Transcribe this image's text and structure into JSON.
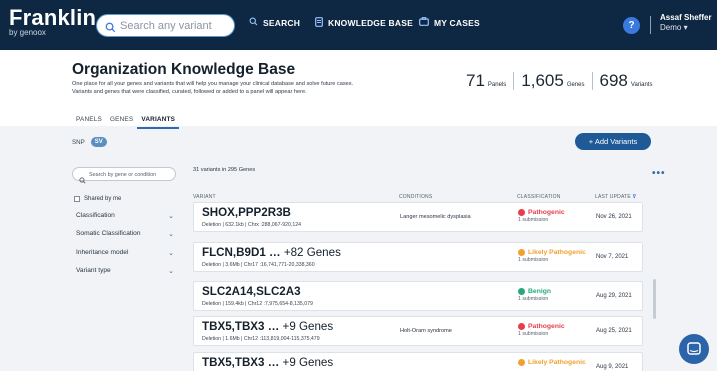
{
  "app": {
    "logo": "Franklin",
    "logo_sub": "by genoox"
  },
  "search": {
    "placeholder": "Search any variant"
  },
  "nav": {
    "search": "SEARCH",
    "knowledge_base": "KNOWLEDGE BASE",
    "my_cases": "MY CASES"
  },
  "user": {
    "name": "Assaf Sheffer",
    "org": "Demo ▾",
    "help": "?"
  },
  "page": {
    "title": "Organization Knowledge Base",
    "desc_line1": "One place for all your genes and variants that will help you manage your clinical database and solve future cases.",
    "desc_line2": "Variants and genes that were classified, curated, followed or added to a panel will appear here."
  },
  "stats": [
    {
      "value": "71",
      "label": "Panels"
    },
    {
      "value": "1,605",
      "label": "Genes"
    },
    {
      "value": "698",
      "label": "Variants"
    }
  ],
  "tabs": [
    "PANELS",
    "GENES",
    "VARIANTS"
  ],
  "chips": {
    "snp": "SNP",
    "sv": "SV"
  },
  "add_button": "+ Add Variants",
  "more": "•••",
  "filters": {
    "search_placeholder": "Search by gene or condition",
    "shared": "Shared by me",
    "items": [
      "Classification",
      "Somatic Classification",
      "Inheritance model",
      "Variant type"
    ]
  },
  "table": {
    "count": "31 variants in 295 Genes",
    "headers": {
      "variant": "VARIANT",
      "conditions": "CONDITIONS",
      "classification": "CLASSIFICATION",
      "last_update": "LAST UPDATE"
    },
    "rows": [
      {
        "name": "SHOX,PPP2R3B",
        "extra": "",
        "detail": "Deletion | 632.1kb | Chrx :288,067-920,124",
        "condition": "Langer mesomelic dysplasia",
        "class": "Pathogenic",
        "class_color": "#e53e4f",
        "sub": "1 submission",
        "date": "Nov 26, 2021"
      },
      {
        "name": "FLCN,B9D1 …",
        "extra": "+82 Genes",
        "detail": "Deletion | 3.6Mb | Chr17 :16,741,771-20,338,360",
        "condition": "",
        "class": "Likely Pathogenic",
        "class_color": "#f0a030",
        "sub": "1 submission",
        "date": "Nov 7, 2021"
      },
      {
        "name": "SLC2A14,SLC2A3",
        "extra": "",
        "detail": "Deletion | 159.4kb | Chr12 :7,975,654-8,135,079",
        "condition": "",
        "class": "Benign",
        "class_color": "#28a87a",
        "sub": "1 submission",
        "date": "Aug 29, 2021"
      },
      {
        "name": "TBX5,TBX3 …",
        "extra": "+9 Genes",
        "detail": "Deletion | 1.6Mb | Chr12 :113,819,004-115,375,479",
        "condition": "Holt-Oram syndrome",
        "class": "Pathogenic",
        "class_color": "#e53e4f",
        "sub": "1 submission",
        "date": "Aug 25, 2021"
      },
      {
        "name": "TBX5,TBX3 …",
        "extra": "+9 Genes",
        "detail": "",
        "condition": "",
        "class": "Likely Pathogenic",
        "class_color": "#f0a030",
        "sub": "",
        "date": "Aug 9, 2021"
      }
    ]
  }
}
